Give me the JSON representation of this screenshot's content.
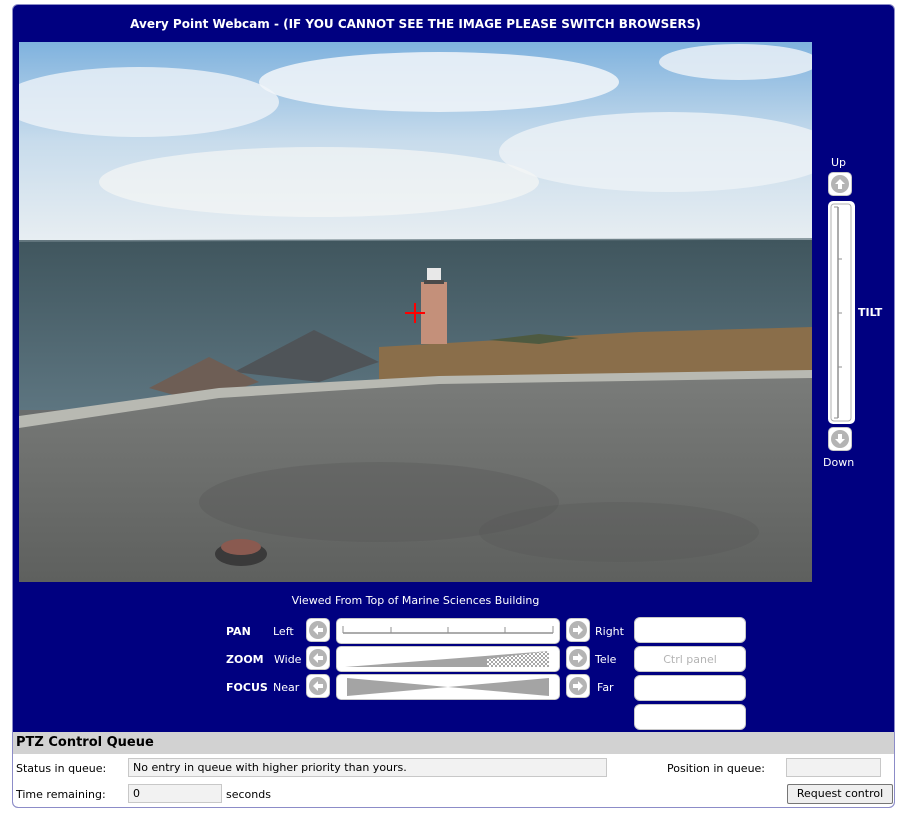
{
  "page": {
    "title": "Avery Point Webcam - (IF YOU CANNOT SEE THE IMAGE PLEASE SWITCH BROWSERS)",
    "caption": "Viewed From Top of Marine Sciences Building"
  },
  "tilt": {
    "up_label": "Up",
    "down_label": "Down",
    "label": "TILT"
  },
  "controls": {
    "pan": {
      "name": "PAN",
      "left": "Left",
      "right": "Right"
    },
    "zoom": {
      "name": "ZOOM",
      "left": "Wide",
      "right": "Tele"
    },
    "focus": {
      "name": "FOCUS",
      "left": "Near",
      "right": "Far"
    },
    "ctrl_panel_label": "Ctrl panel"
  },
  "queue": {
    "heading": "PTZ Control Queue",
    "status_label": "Status in queue:",
    "status_value": "No entry in queue with higher priority than yours.",
    "position_label": "Position in queue:",
    "position_value": "",
    "time_label": "Time remaining:",
    "time_value": "0",
    "time_unit": "seconds",
    "request_button": "Request control"
  },
  "icons": {
    "up": "arrow-up-icon",
    "down": "arrow-down-icon",
    "left": "arrow-left-icon",
    "right": "arrow-right-icon"
  },
  "colors": {
    "background": "#000080",
    "crosshair": "#ff0000"
  }
}
